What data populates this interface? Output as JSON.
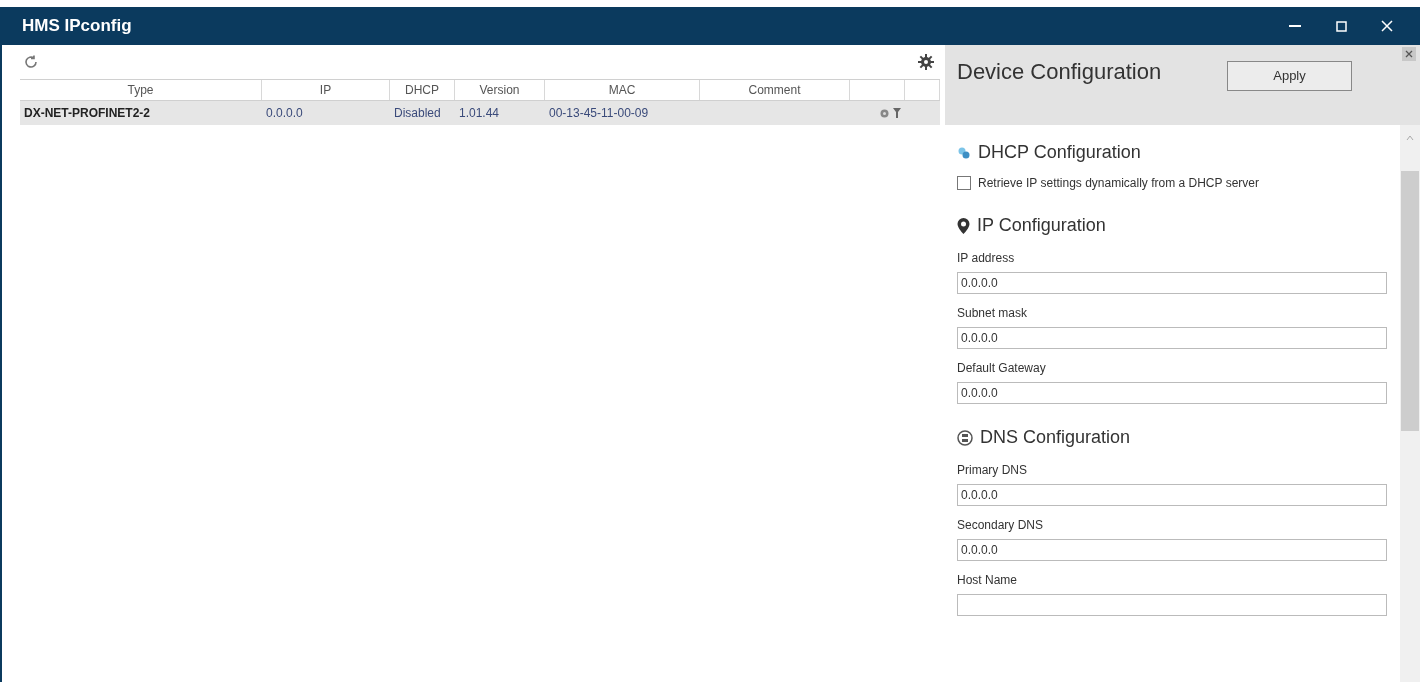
{
  "window": {
    "title": "HMS IPconfig"
  },
  "table": {
    "columns": [
      "Type",
      "IP",
      "DHCP",
      "Version",
      "MAC",
      "Comment"
    ],
    "rows": [
      {
        "selected": true,
        "cells": [
          "DX-NET-PROFINET2-2",
          "0.0.0.0",
          "Disabled",
          "1.01.44",
          "00-13-45-11-00-09",
          ""
        ]
      }
    ]
  },
  "panel": {
    "title": "Device Configuration",
    "apply_button": "Apply",
    "sections": [
      {
        "title": "DHCP Configuration",
        "items": [
          {
            "kind": "checkbox",
            "label": "Retrieve IP settings dynamically from a DHCP server",
            "checked": false
          }
        ]
      },
      {
        "title": "IP Configuration",
        "items": [
          {
            "kind": "field",
            "label": "IP address",
            "value": "0.0.0.0"
          },
          {
            "kind": "field",
            "label": "Subnet mask",
            "value": "0.0.0.0"
          },
          {
            "kind": "field",
            "label": "Default Gateway",
            "value": "0.0.0.0"
          }
        ]
      },
      {
        "title": "DNS Configuration",
        "items": [
          {
            "kind": "field",
            "label": "Primary DNS",
            "value": "0.0.0.0"
          },
          {
            "kind": "field",
            "label": "Secondary DNS",
            "value": "0.0.0.0"
          },
          {
            "kind": "field",
            "label": "Host Name"
          }
        ]
      }
    ]
  }
}
